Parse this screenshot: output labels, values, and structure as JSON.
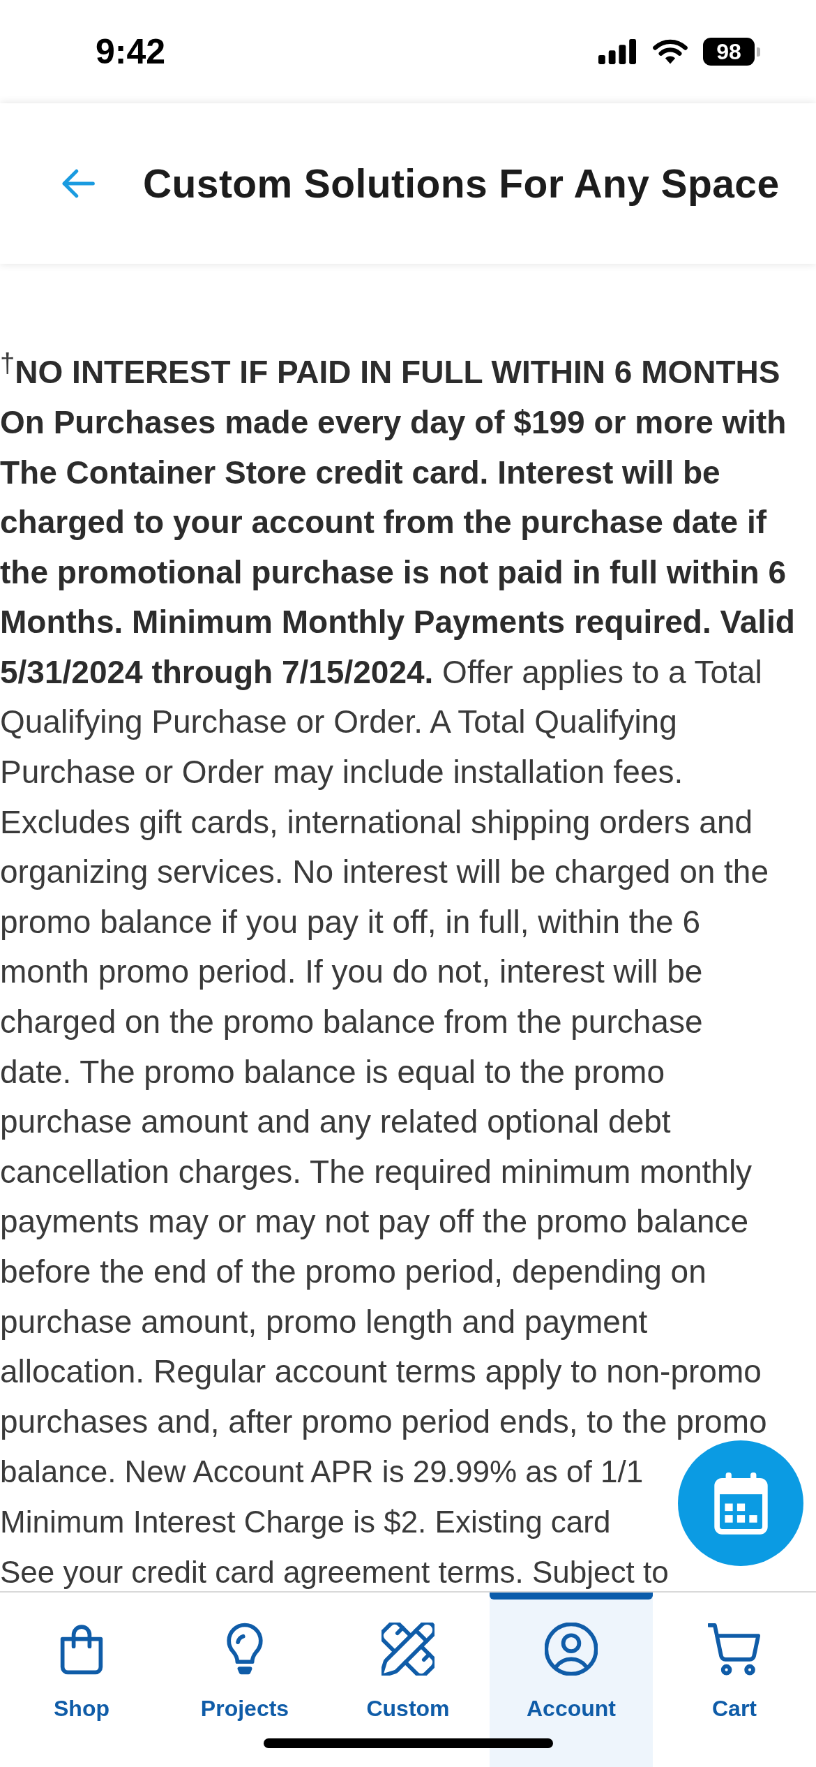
{
  "status_bar": {
    "time": "9:42",
    "battery": "98"
  },
  "header": {
    "title": "Custom Solutions For Any Space"
  },
  "terms": {
    "lines": [
      "$^{†}$**NO INTEREST IF PAID IN FULL WITHIN 6 MONTHS**",
      "**On Purchases made every day of $199 or more with**",
      "**The Container Store credit card. Interest will be**",
      "**charged to your account from the purchase date if**",
      "**the promotional purchase is not paid in full within 6**",
      "**Months. Minimum Monthly Payments required. Valid**",
      "**5/31/2024 through 7/15/2024.** Offer applies to a Total",
      "Qualifying Purchase or Order. A Total Qualifying",
      "Purchase or Order may include installation fees.",
      "Excludes gift cards, international shipping orders and",
      "organizing services. No interest will be charged on the",
      "promo balance if you pay it off, in full, within the 6",
      "month promo period. If you do not, interest will be",
      "charged on the promo balance from the purchase",
      "date. The promo balance is equal to the promo",
      "purchase amount and any related optional debt",
      "cancellation charges. The required minimum monthly",
      "payments may or may not pay off the promo balance",
      "before the end of the promo period, depending on",
      "purchase amount, promo length and payment",
      "allocation. Regular account terms apply to non-promo",
      "purchases and, after promo period ends, to the promo"
    ],
    "tail_lines": [
      "balance. New Account APR is 29.99% as of 1/1",
      "Minimum Interest Charge is $2. Existing card",
      "See your credit card agreement terms. Subject to"
    ]
  },
  "tab_bar": {
    "tabs": [
      {
        "label": "Shop",
        "selected": false
      },
      {
        "label": "Projects",
        "selected": false
      },
      {
        "label": "Custom",
        "selected": false
      },
      {
        "label": "Account",
        "selected": true
      },
      {
        "label": "Cart",
        "selected": false
      }
    ]
  }
}
